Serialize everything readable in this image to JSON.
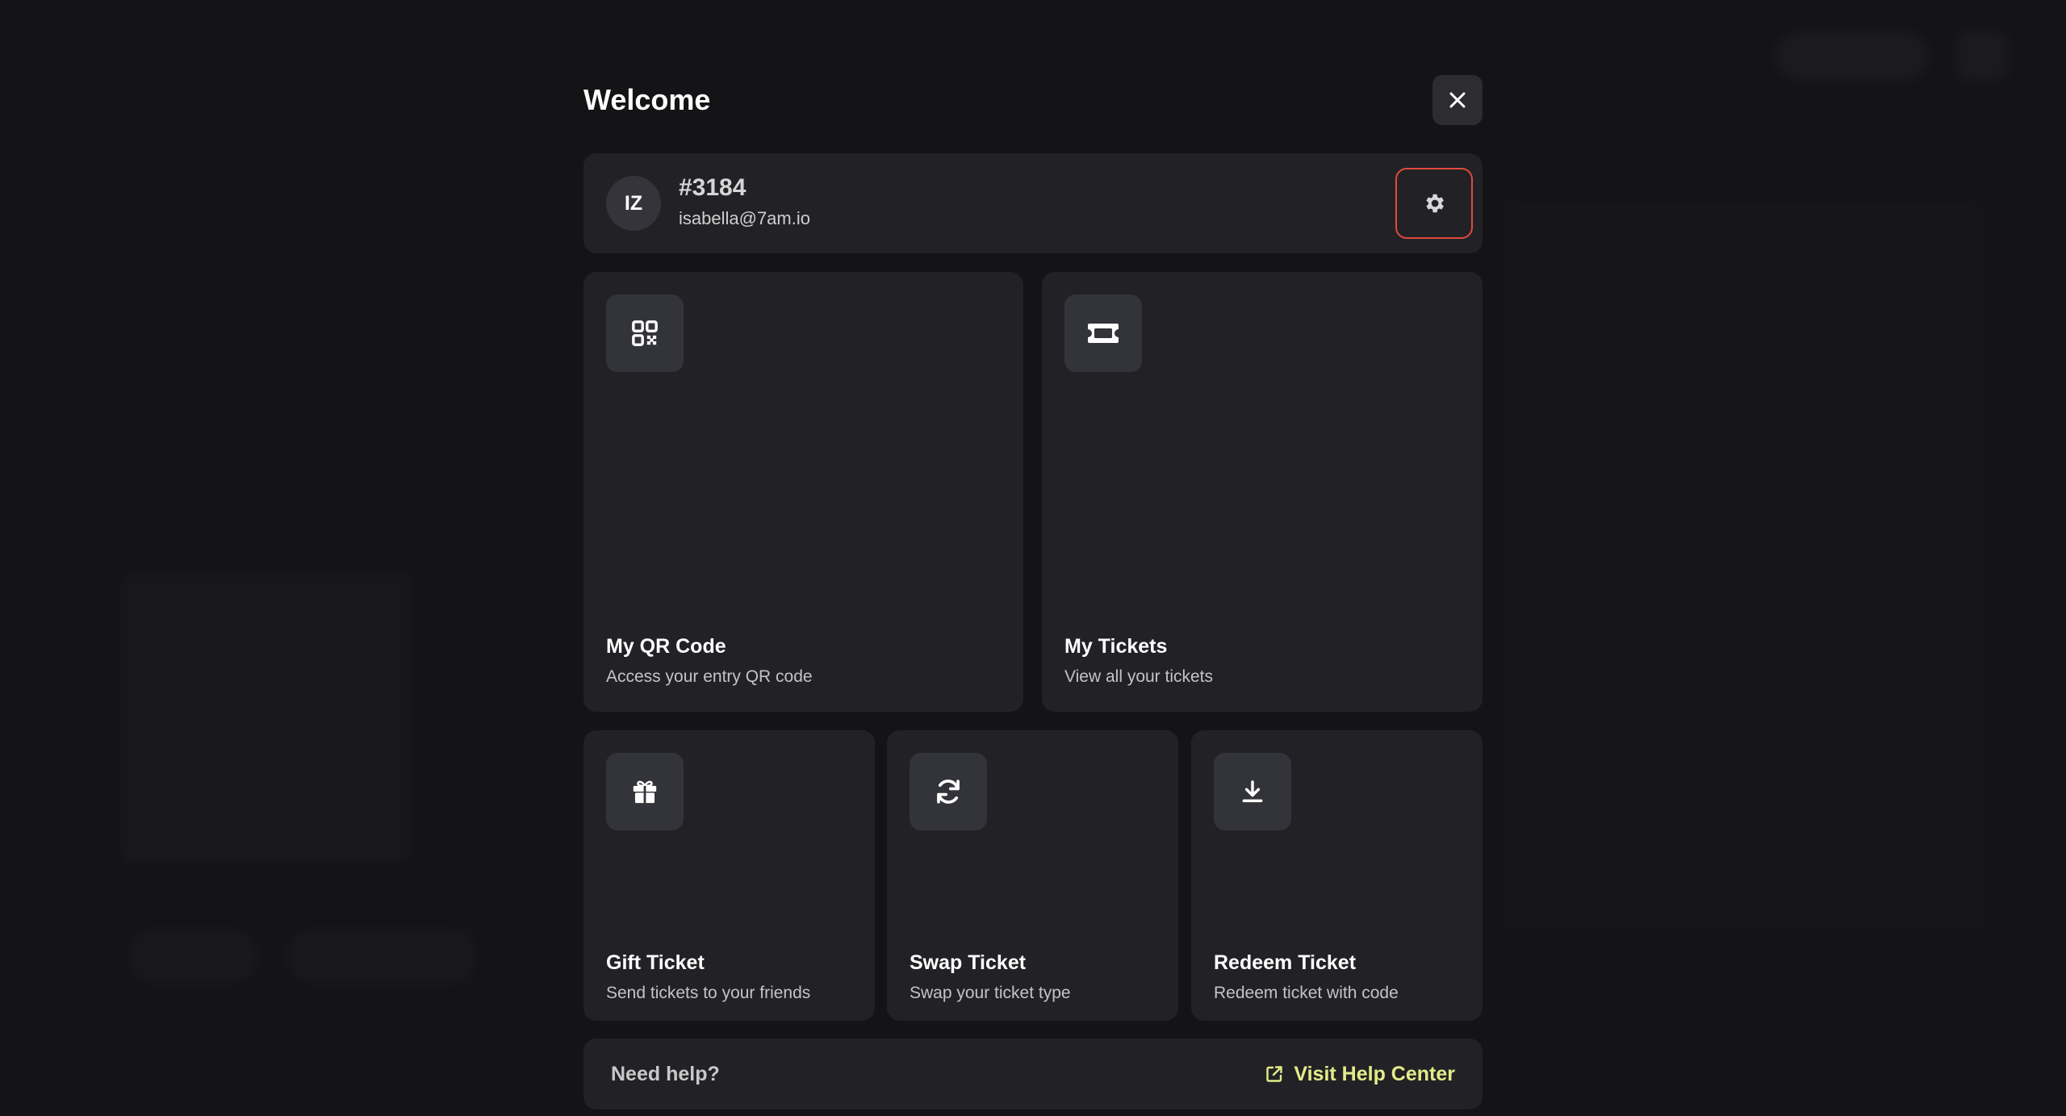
{
  "modal": {
    "title": "Welcome",
    "close_icon": "close-icon"
  },
  "user": {
    "initials": "IZ",
    "id": "#3184",
    "email": "isabella@7am.io",
    "settings_icon": "gear-icon",
    "settings_outline_color": "#e04a3c"
  },
  "tiles": {
    "qr": {
      "icon": "qr-code-icon",
      "title": "My QR Code",
      "subtitle": "Access your entry QR code"
    },
    "tickets": {
      "icon": "ticket-icon",
      "title": "My Tickets",
      "subtitle": "View all your tickets"
    },
    "gift": {
      "icon": "gift-icon",
      "title": "Gift Ticket",
      "subtitle": "Send tickets to your friends"
    },
    "swap": {
      "icon": "swap-icon",
      "title": "Swap Ticket",
      "subtitle": "Swap your ticket type"
    },
    "redeem": {
      "icon": "download-icon",
      "title": "Redeem Ticket",
      "subtitle": "Redeem ticket with code"
    }
  },
  "help": {
    "label": "Need help?",
    "link": "Visit Help Center",
    "link_icon": "external-link-icon",
    "accent_color": "#e3ec8a"
  },
  "colors": {
    "background": "#141416",
    "card": "#222226",
    "icon_box": "#33333a"
  }
}
